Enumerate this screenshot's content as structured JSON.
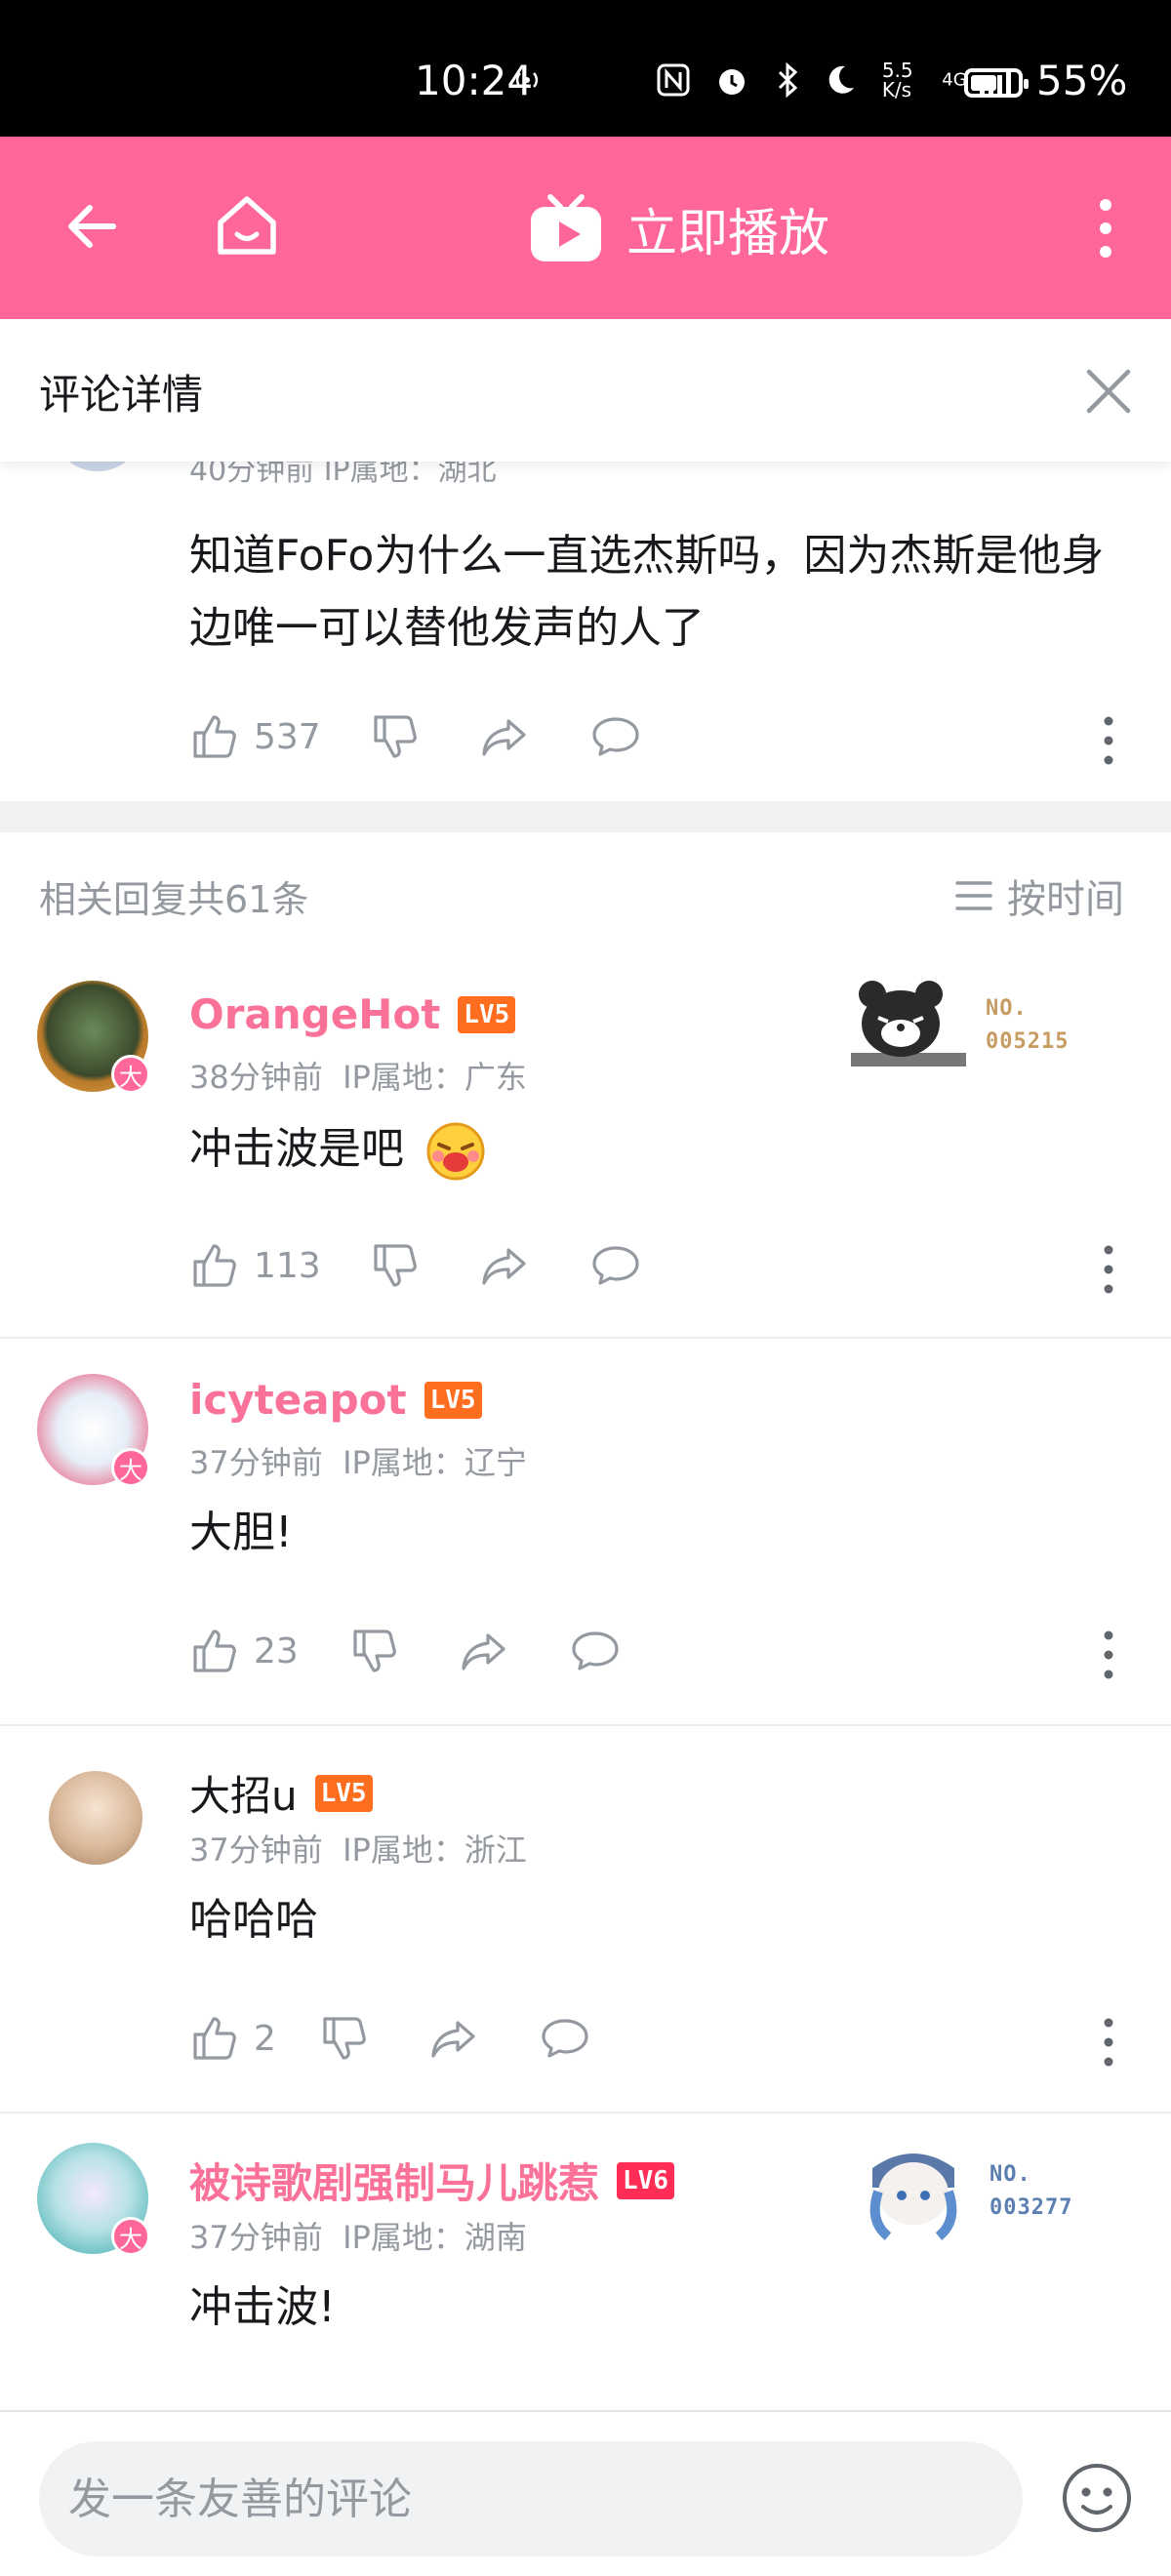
{
  "status_bar": {
    "time": "10:24",
    "net_speed": "5.5 K/s",
    "signal": "4G",
    "battery": "55%",
    "battery_level": 0.55
  },
  "header": {
    "play_label": "立即播放",
    "accent_color": "#ff6699"
  },
  "detail_bar": {
    "title": "评论详情"
  },
  "main_comment": {
    "meta": "40分钟前  IP属地：湖北",
    "text": "知道FoFo为什么一直选杰斯吗，因为杰斯是他身边唯一可以替他发声的人了",
    "likes": "537"
  },
  "replies_header": {
    "count_label": "相关回复共61条",
    "sort_label": "按时间"
  },
  "replies": [
    {
      "username": "OrangeHot",
      "level": "LV5",
      "time": "38分钟前",
      "ip": "IP属地：广东",
      "text": "冲击波是吧",
      "likes": "113",
      "medal_no": "NO.",
      "medal_id": "005215",
      "avatar_badge": "大"
    },
    {
      "username": "icyteapot",
      "level": "LV5",
      "time": "37分钟前",
      "ip": "IP属地：辽宁",
      "text": "大胆!",
      "likes": "23",
      "avatar_badge": "大"
    },
    {
      "username": "大招u",
      "level": "LV5",
      "time": "37分钟前",
      "ip": "IP属地：浙江",
      "text": "哈哈哈",
      "likes": "2"
    },
    {
      "username": "被诗歌剧强制马儿跳惹",
      "level": "LV6",
      "time": "37分钟前",
      "ip": "IP属地：湖南",
      "text": "冲击波!",
      "medal_no": "NO.",
      "medal_id": "003277",
      "avatar_badge": "大"
    }
  ],
  "bottom_bar": {
    "placeholder": "发一条友善的评论"
  }
}
